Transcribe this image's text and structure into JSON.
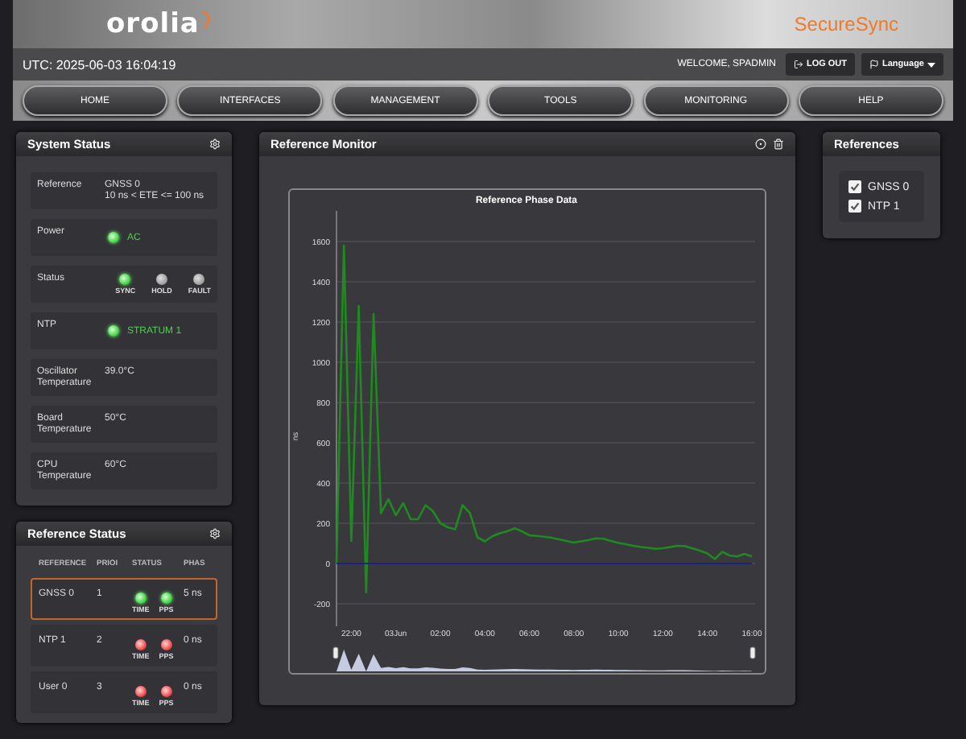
{
  "header": {
    "logo": "orolia",
    "product": "SecureSync"
  },
  "status_bar": {
    "utc": "UTC: 2025-06-03 16:04:19",
    "welcome": "WELCOME, SPADMIN",
    "logout": "LOG OUT",
    "language": "Language"
  },
  "nav": [
    {
      "label": "HOME"
    },
    {
      "label": "INTERFACES"
    },
    {
      "label": "MANAGEMENT"
    },
    {
      "label": "TOOLS"
    },
    {
      "label": "MONITORING"
    },
    {
      "label": "HELP"
    }
  ],
  "system_status": {
    "title": "System Status",
    "rows": [
      {
        "kind": "text",
        "label": "Reference",
        "lines": [
          "GNSS 0",
          "10 ns < ETE <= 100 ns"
        ]
      },
      {
        "kind": "led",
        "label": "Power",
        "on": true,
        "value": "AC"
      },
      {
        "kind": "leds",
        "label": "Status",
        "leds": [
          {
            "label": "SYNC",
            "on": true
          },
          {
            "label": "HOLD",
            "on": false
          },
          {
            "label": "FAULT",
            "on": false
          }
        ]
      },
      {
        "kind": "led",
        "label": "NTP",
        "on": true,
        "value": "STRATUM 1"
      },
      {
        "kind": "text",
        "label": "Oscillator Temperature",
        "lines": [
          "39.0°C"
        ]
      },
      {
        "kind": "text",
        "label": "Board Temperature",
        "lines": [
          "50°C"
        ]
      },
      {
        "kind": "text",
        "label": "CPU Temperature",
        "lines": [
          "60°C"
        ]
      }
    ]
  },
  "reference_status": {
    "title": "Reference Status",
    "columns": [
      "REFERENCE",
      "PRIOI",
      "STATUS",
      "PHAS"
    ],
    "rows": [
      {
        "reference": "GNSS 0",
        "priority": "1",
        "leds": [
          {
            "label": "TIME",
            "ok": true
          },
          {
            "label": "PPS",
            "ok": true
          }
        ],
        "phase": "5 ns",
        "selected": true
      },
      {
        "reference": "NTP 1",
        "priority": "2",
        "leds": [
          {
            "label": "TIME",
            "ok": false
          },
          {
            "label": "PPS",
            "ok": false
          }
        ],
        "phase": "0 ns",
        "selected": false
      },
      {
        "reference": "User 0",
        "priority": "3",
        "leds": [
          {
            "label": "TIME",
            "ok": false
          },
          {
            "label": "PPS",
            "ok": false
          }
        ],
        "phase": "0 ns",
        "selected": false
      }
    ]
  },
  "reference_monitor": {
    "title": "Reference Monitor",
    "chart_data": {
      "type": "line",
      "title": "Reference Phase Data",
      "ylabel": "ns",
      "categories": [
        null,
        null,
        "22:00",
        null,
        null,
        null,
        null,
        null,
        "03Jun",
        null,
        null,
        null,
        null,
        null,
        "02:00",
        null,
        null,
        null,
        null,
        null,
        "04:00",
        null,
        null,
        null,
        null,
        null,
        "06:00",
        null,
        null,
        null,
        null,
        null,
        "08:00",
        null,
        null,
        null,
        null,
        null,
        "10:00",
        null,
        null,
        null,
        null,
        null,
        "12:00",
        null,
        null,
        null,
        null,
        null,
        "14:00",
        null,
        null,
        null,
        null,
        null,
        "16:00"
      ],
      "series": [
        {
          "color": "#1f8a1f",
          "values": [
            0,
            1580,
            112,
            1280,
            -144,
            1240,
            250,
            320,
            240,
            300,
            220,
            220,
            290,
            260,
            200,
            180,
            170,
            290,
            250,
            130,
            110,
            135,
            150,
            160,
            175,
            160,
            140,
            137,
            133,
            128,
            120,
            112,
            104,
            110,
            117,
            125,
            123,
            112,
            102,
            96,
            88,
            82,
            78,
            73,
            76,
            82,
            88,
            86,
            75,
            64,
            50,
            22,
            58,
            40,
            35,
            48,
            35
          ]
        },
        {
          "color": "#1a237e",
          "values": [
            0,
            0,
            0,
            0,
            0,
            0,
            0,
            0,
            0,
            0,
            0,
            0,
            0,
            0,
            0,
            0,
            0,
            0,
            0,
            0,
            0,
            0,
            0,
            0,
            0,
            0,
            0,
            0,
            0,
            0,
            0,
            0,
            0,
            0,
            0,
            0,
            0,
            0,
            0,
            0,
            0,
            0,
            0,
            0,
            0,
            0,
            0,
            0,
            0,
            0,
            0,
            0,
            0,
            0,
            0,
            0,
            0
          ]
        }
      ],
      "ylim": [
        -312,
        1752
      ],
      "grid": true,
      "yticks": [
        -200,
        0,
        200,
        400,
        600,
        800,
        1000,
        1200,
        1400,
        1600
      ]
    }
  },
  "references": {
    "title": "References",
    "items": [
      {
        "label": "GNSS 0",
        "checked": true
      },
      {
        "label": "NTP 1",
        "checked": true
      }
    ]
  }
}
